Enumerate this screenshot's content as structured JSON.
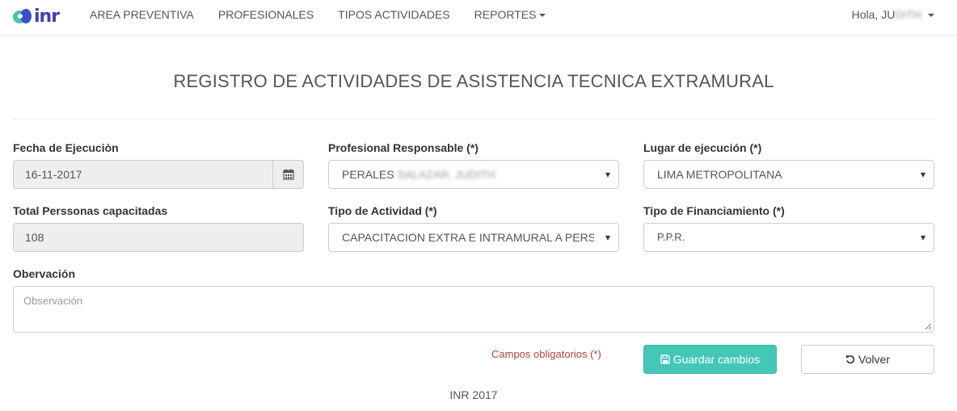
{
  "brand": {
    "logo_text": "inr"
  },
  "nav": {
    "items": [
      {
        "label": "AREA PREVENTIVA"
      },
      {
        "label": "PROFESIONALES"
      },
      {
        "label": "TIPOS ACTIVIDADES"
      },
      {
        "label": "REPORTES"
      }
    ],
    "user_greeting": "Hola, JU",
    "user_name_obscured": "DITH"
  },
  "page": {
    "title": "REGISTRO DE ACTIVIDADES DE ASISTENCIA TECNICA EXTRAMURAL"
  },
  "form": {
    "fecha": {
      "label": "Fecha de Ejecuciòn",
      "value": "16-11-2017"
    },
    "profesional": {
      "label": "Profesional Responsable (*)",
      "value_visible": "PERALES ",
      "value_obscured": "SALAZAR, JUDITH"
    },
    "lugar": {
      "label": "Lugar de ejecución (*)",
      "value": "LIMA METROPOLITANA"
    },
    "total": {
      "label": "Total Perssonas capacitadas",
      "value": "108"
    },
    "tipo_actividad": {
      "label": "Tipo de Actividad (*)",
      "value": "CAPACITACION EXTRA E INTRAMURAL A PERSONAL DE SALUD"
    },
    "financiamiento": {
      "label": "Tipo de Financiamiento (*)",
      "value": "P.P.R."
    },
    "observacion": {
      "label": "Obervación",
      "placeholder": "Observación"
    },
    "required_note": "Campos obligatorios (*)",
    "save_label": "Guardar cambios",
    "back_label": "Volver"
  },
  "icons": {
    "calendar": "calendar-icon",
    "save": "floppy-disk-icon",
    "back": "undo-arrow-icon",
    "dropdown": "chevron-down-icon"
  },
  "colors": {
    "brand_teal": "#45c4b0",
    "brand_blue": "#3d3fb0",
    "save_button": "#45c7b7",
    "required_text": "#a94442"
  },
  "footer": {
    "text": "INR 2017"
  }
}
